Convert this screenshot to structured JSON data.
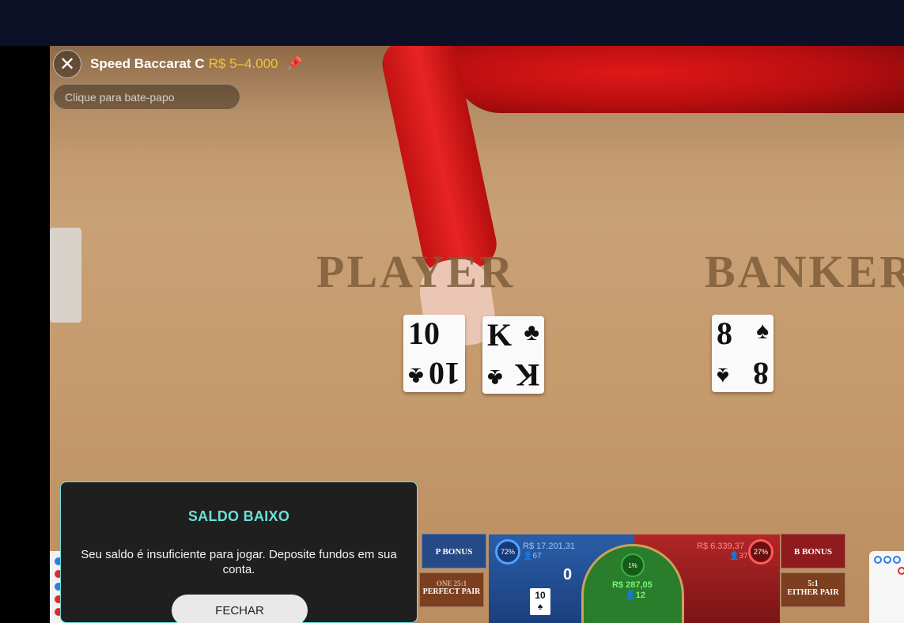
{
  "header": {
    "game_title": "Speed Baccarat C",
    "limits": "R$ 5–4.000",
    "close_icon": "close-icon",
    "pin_icon": "pin-icon"
  },
  "chat": {
    "placeholder": "Clique para bate-papo"
  },
  "table": {
    "player_word": "PLAYER",
    "banker_word": "BANKER",
    "player_cards": [
      {
        "rank": "10",
        "suit": "♣"
      },
      {
        "rank": "K",
        "suit": "♣"
      }
    ],
    "banker_cards": [
      {
        "rank": "8",
        "suit": "♠"
      }
    ]
  },
  "betting": {
    "p_bonus": "P BONUS",
    "b_bonus": "B BONUS",
    "perfect_pair": {
      "odds": "ONE 25:1",
      "label": "PERFECT PAIR"
    },
    "either_pair": {
      "odds": "5:1",
      "label": "EITHER PAIR"
    },
    "player": {
      "pct": "72%",
      "amount": "R$ 17.201,31",
      "players": "67",
      "score": "0",
      "card": "10"
    },
    "banker": {
      "pct": "27%",
      "amount": "R$ 6.339,37",
      "players": "37"
    },
    "tie": {
      "pct": "1%",
      "amount": "R$ 287,05",
      "players": "12"
    }
  },
  "modal": {
    "title": "SALDO BAIXO",
    "message": "Seu saldo é insuficiente para jogar. Deposite fundos em sua conta.",
    "button": "FECHAR"
  },
  "colors": {
    "accent": "#6be0d8",
    "limits": "#f4c430",
    "player": "#2a5ea8",
    "banker": "#b22627",
    "tie": "#2a7d2a"
  }
}
